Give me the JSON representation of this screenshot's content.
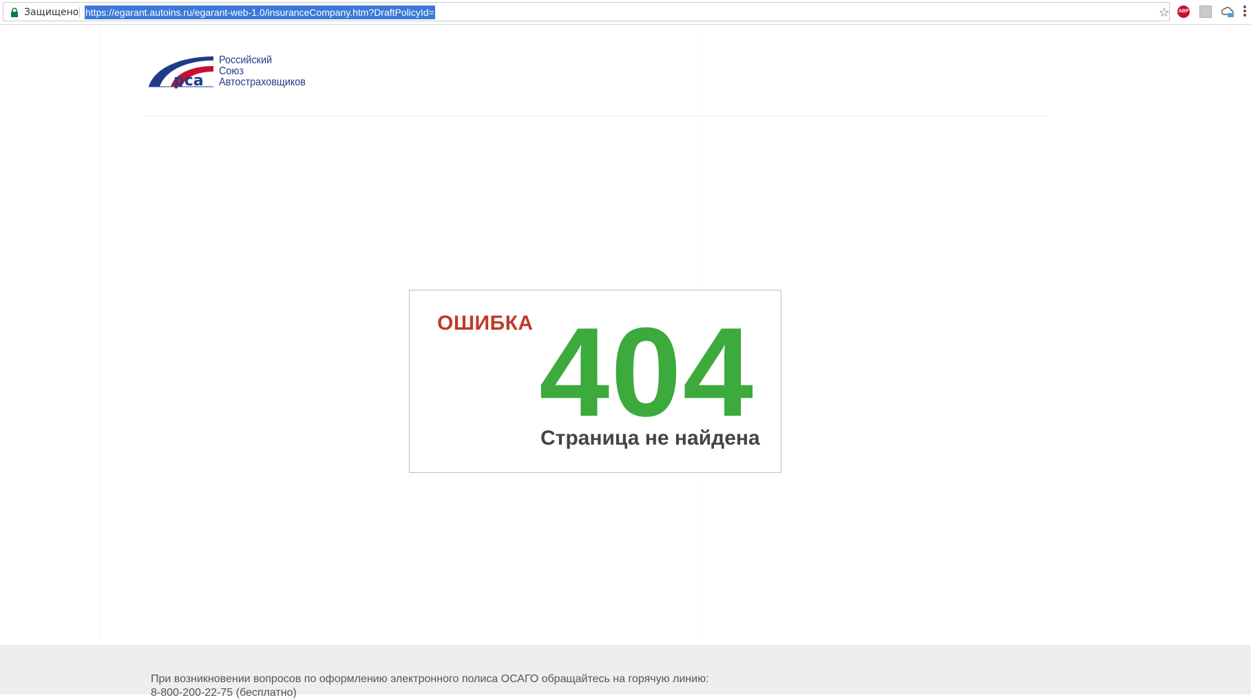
{
  "browser": {
    "secure_label": "Защищено",
    "url": "https://egarant.autoins.ru/egarant-web-1.0/insuranceCompany.htm?DraftPolicyId=",
    "abp_label": "ABP",
    "icons": [
      "lock-icon",
      "star-icon",
      "adblock-icon",
      "extension-icon",
      "cloud-icon",
      "menu-icon"
    ]
  },
  "header": {
    "logo_lines": [
      "Российский",
      "Союз",
      "Автостраховщиков"
    ]
  },
  "error": {
    "label": "ОШИБКА",
    "code": "404",
    "message": "Страница не найдена"
  },
  "footer": {
    "line1": "При возникновении вопросов по оформлению электронного полиса ОСАГО обращайтесь на горячую линию:",
    "line2": "8-800-200-22-75 (бесплатно)"
  },
  "colors": {
    "error_label": "#c0392b",
    "error_code": "#3caa3c",
    "brand_blue": "#1f3c88",
    "brand_red": "#c8102e"
  }
}
